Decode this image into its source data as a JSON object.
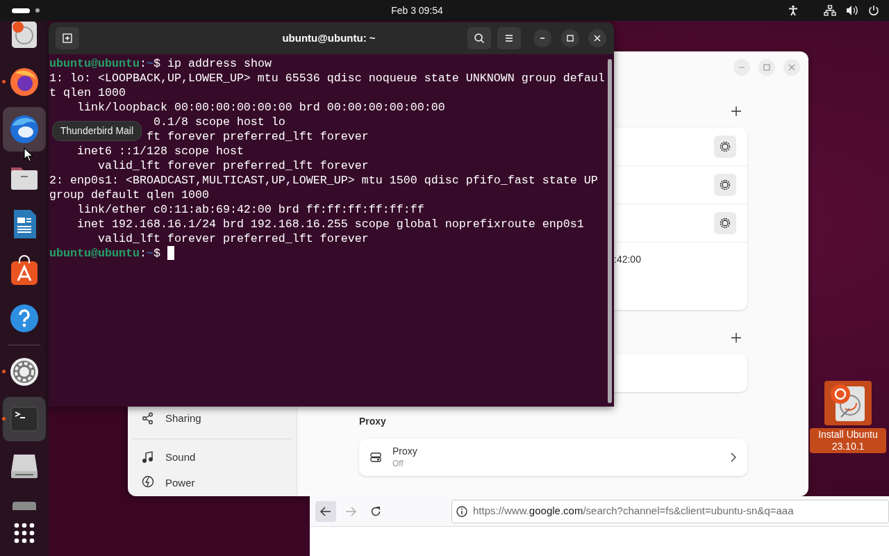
{
  "top_bar": {
    "clock": "Feb 3  09:54"
  },
  "dock": {
    "items": [
      {
        "running": false,
        "selected": false,
        "hovered": false
      },
      {
        "running": true,
        "selected": false,
        "hovered": false
      },
      {
        "running": false,
        "selected": false,
        "hovered": true
      },
      {
        "running": false,
        "selected": false,
        "hovered": false
      },
      {
        "running": false,
        "selected": false,
        "hovered": false
      },
      {
        "running": false,
        "selected": false,
        "hovered": false
      },
      {
        "running": false,
        "selected": false,
        "hovered": false
      },
      {
        "running": true,
        "selected": false,
        "hovered": false
      },
      {
        "running": true,
        "selected": true,
        "hovered": false
      },
      {
        "running": false,
        "selected": false,
        "hovered": false
      },
      {
        "running": false,
        "selected": false,
        "hovered": false
      }
    ],
    "tooltip": "Thunderbird Mail"
  },
  "terminal": {
    "title": "ubuntu@ubuntu: ~",
    "lines": [
      {
        "kind": "prompt",
        "user": "ubuntu@ubuntu",
        "separator": ":",
        "path": "~",
        "command": "$ ip address show",
        "cursor": false
      },
      {
        "kind": "output",
        "text": "1: lo: <LOOPBACK,UP,LOWER_UP> mtu 65536 qdisc noqueue state UNKNOWN group defaul"
      },
      {
        "kind": "output",
        "text": "t qlen 1000"
      },
      {
        "kind": "output",
        "text": "    link/loopback 00:00:00:00:00:00 brd 00:00:00:00:00:00"
      },
      {
        "kind": "output",
        "text": "               0.1/8 scope host lo"
      },
      {
        "kind": "output",
        "text": "              ft forever preferred_lft forever"
      },
      {
        "kind": "output",
        "text": "    inet6 ::1/128 scope host"
      },
      {
        "kind": "output",
        "text": "       valid_lft forever preferred_lft forever"
      },
      {
        "kind": "output",
        "text": "2: enp0s1: <BROADCAST,MULTICAST,UP,LOWER_UP> mtu 1500 qdisc pfifo_fast state UP"
      },
      {
        "kind": "output",
        "text": "group default qlen 1000"
      },
      {
        "kind": "output",
        "text": "    link/ether c0:11:ab:69:42:00 brd ff:ff:ff:ff:ff:ff"
      },
      {
        "kind": "output",
        "text": "    inet 192.168.16.1/24 brd 192.168.16.255 scope global noprefixroute enp0s1"
      },
      {
        "kind": "output",
        "text": "       valid_lft forever preferred_lft forever"
      },
      {
        "kind": "prompt",
        "user": "ubuntu@ubuntu",
        "separator": ":",
        "path": "~",
        "command": "$",
        "cursor": true
      }
    ]
  },
  "settings": {
    "sidebar": [
      {
        "label": "Sharing",
        "divider_above": false
      },
      {
        "label": "Sound",
        "divider_above": true
      },
      {
        "label": "Power",
        "divider_above": false
      }
    ],
    "groups": [
      {
        "rows": [
          {
            "has_settings": true
          },
          {
            "has_settings": true
          },
          {
            "has_settings": true
          }
        ],
        "detail": ":42:00",
        "empty": false
      },
      {
        "empty": true
      }
    ],
    "proxy": {
      "heading": "Proxy",
      "title": "Proxy",
      "status": "Off"
    }
  },
  "desktop_icons": [
    {
      "label": "Install Ubuntu 23.10.1",
      "selected": true
    }
  ],
  "browser": {
    "back_enabled": true,
    "forward_enabled": false,
    "url": {
      "scheme": "https://www.",
      "domain": "google.com",
      "path": "/search?channel=fs&client=ubuntu-sn&q=aaa"
    }
  }
}
